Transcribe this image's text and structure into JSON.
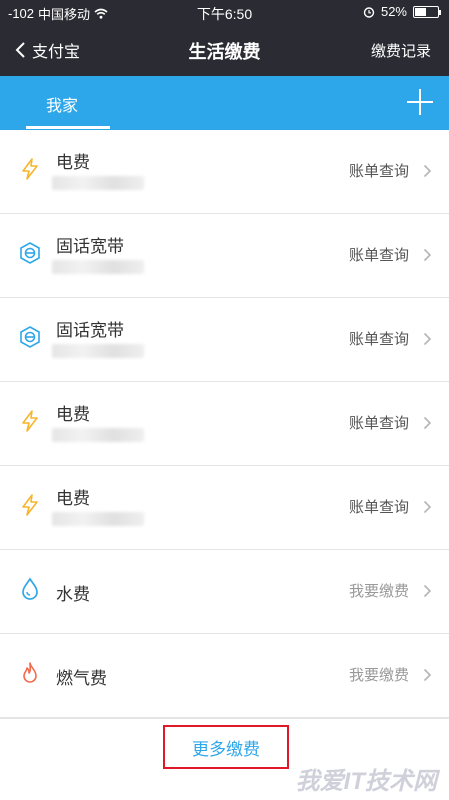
{
  "status_bar": {
    "signal": "-102",
    "carrier": "中国移动",
    "time": "下午6:50",
    "battery_percent": "52%",
    "battery_level": 0.52
  },
  "navbar": {
    "back_label": "支付宝",
    "title": "生活缴费",
    "right_link": "缴费记录"
  },
  "tabs": {
    "active": "我家"
  },
  "bills": [
    {
      "name": "电费",
      "icon": "lightning-icon",
      "action": "账单查询",
      "has_account": true
    },
    {
      "name": "固话宽带",
      "icon": "broadband-icon",
      "action": "账单查询",
      "has_account": true
    },
    {
      "name": "固话宽带",
      "icon": "broadband-icon",
      "action": "账单查询",
      "has_account": true
    },
    {
      "name": "电费",
      "icon": "lightning-icon",
      "action": "账单查询",
      "has_account": true
    },
    {
      "name": "电费",
      "icon": "lightning-icon",
      "action": "账单查询",
      "has_account": true
    },
    {
      "name": "水费",
      "icon": "water-drop-icon",
      "action": "我要缴费",
      "has_account": false
    },
    {
      "name": "燃气费",
      "icon": "flame-icon",
      "action": "我要缴费",
      "has_account": false
    }
  ],
  "footer": {
    "more_label": "更多缴费",
    "watermark": "我爱IT技术网"
  },
  "colors": {
    "header_bg": "#2b2b33",
    "tab_bg": "#2ea7ea",
    "accent_blue": "#2ea7ea",
    "lightning": "#f7b52c",
    "flame": "#f26b4f",
    "highlight_box": "#e0182a"
  }
}
